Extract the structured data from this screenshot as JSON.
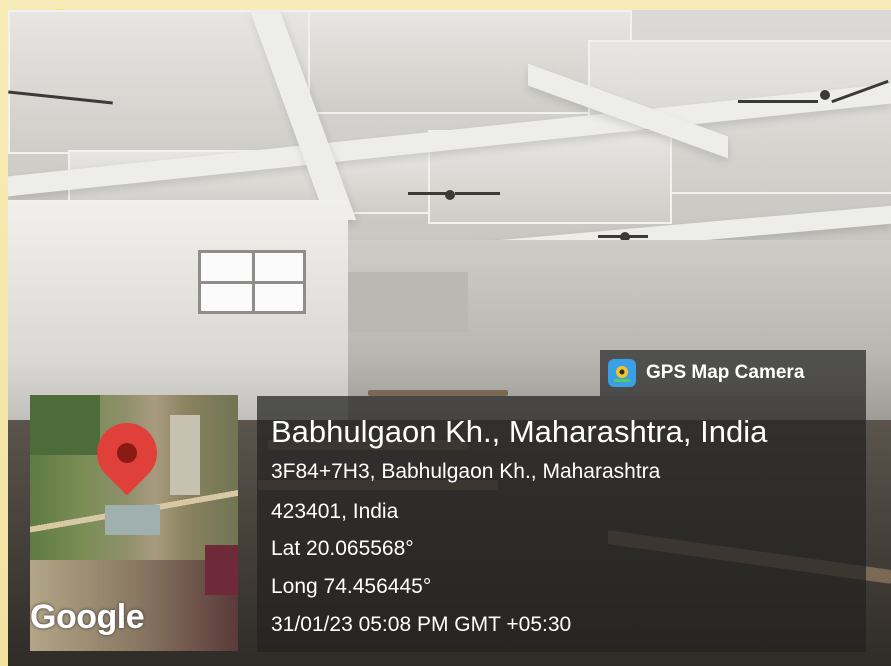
{
  "badge": {
    "label": "GPS Map Camera",
    "icon": "gps-map-camera-icon",
    "icon_color": "#3aa0e6"
  },
  "map": {
    "watermark": "Google",
    "pin_color": "#e0403a",
    "icon": "map-pin-icon"
  },
  "location": {
    "title": "Babhulgaon Kh., Maharashtra, India",
    "address_line1": "3F84+7H3, Babhulgaon Kh., Maharashtra",
    "address_line2": "423401, India",
    "lat": "Lat 20.065568°",
    "long": "Long 74.456445°",
    "datetime": "31/01/23 05:08 PM GMT +05:30"
  }
}
